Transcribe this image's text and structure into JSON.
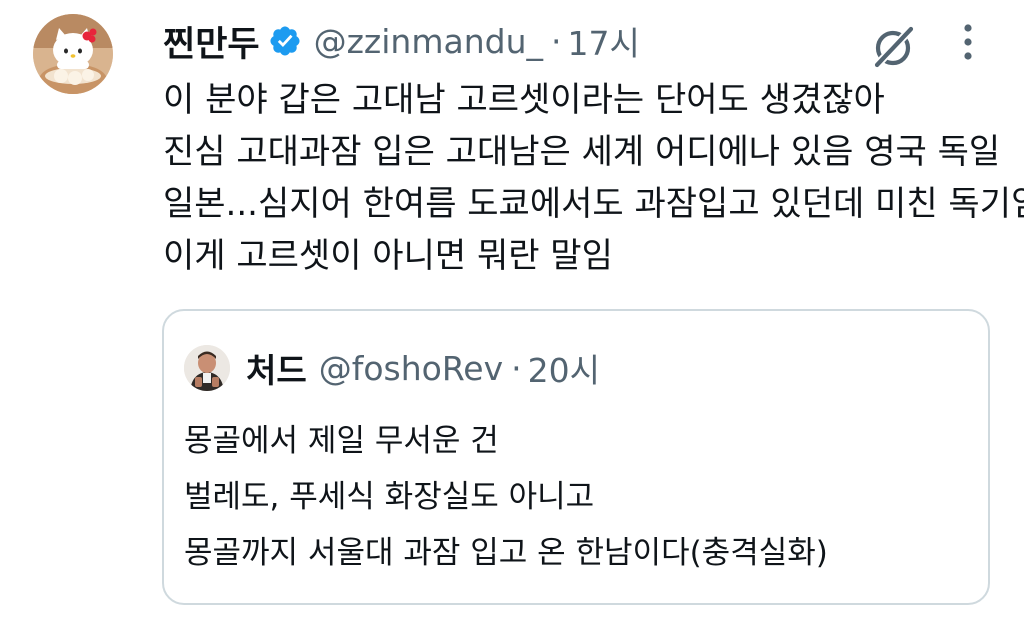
{
  "tweet": {
    "author": {
      "display_name": "찐만두",
      "handle": "@zzinmandu_",
      "avatar_icon": "hello-kitty-avatar",
      "verified_icon": "verified-badge-icon",
      "verified_color": "#1d9bf0"
    },
    "separator": "·",
    "time": "17시",
    "text_lines": [
      "이 분야 갑은 고대남 고르셋이라는 단어도 생겼잖아",
      "진심 고대과잠 입은 고대남은 세계 어디에나 있음 영국 독일",
      "일본...심지어 한여름 도쿄에서도 과잠입고 있던데 미친 독기임",
      "이게 고르셋이 아니면 뭐란 말임"
    ],
    "actions": {
      "grok_icon": "grok-icon",
      "more_icon": "more-options-icon"
    }
  },
  "quoted_tweet": {
    "author": {
      "display_name": "처드",
      "handle": "@foshoRev",
      "avatar_icon": "profile-avatar"
    },
    "separator": "·",
    "time": "20시",
    "text_lines": [
      "몽골에서 제일 무서운 건",
      "벌레도, 푸세식 화장실도 아니고",
      "몽골까지 서울대 과잠 입고 온 한남이다(충격실화)"
    ]
  },
  "colors": {
    "text_primary": "#0f1419",
    "text_secondary": "#536471",
    "border": "#cfd9de",
    "verified": "#1d9bf0"
  }
}
